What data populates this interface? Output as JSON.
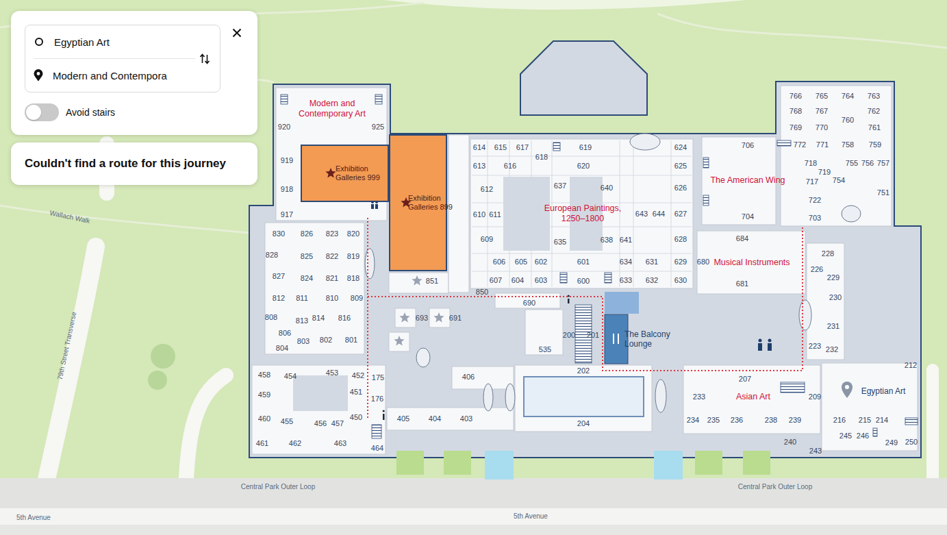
{
  "route_panel": {
    "from": "Egyptian Art",
    "to": "Modern and Contempora"
  },
  "avoid_stairs": {
    "label": "Avoid stairs",
    "on": false
  },
  "message": "Couldn't find a route for this journey",
  "areas": [
    {
      "text": "Modern and Contemporary Art",
      "kind": "department"
    },
    {
      "text": "Exhibition Galleries 999",
      "kind": "exhibition"
    },
    {
      "text": "Exhibition Galleries 899",
      "kind": "exhibition"
    },
    {
      "text": "European Paintings, 1250–1800",
      "kind": "department"
    },
    {
      "text": "The American Wing",
      "kind": "department"
    },
    {
      "text": "Musical Instruments",
      "kind": "department"
    },
    {
      "text": "Asian Art",
      "kind": "department"
    },
    {
      "text": "Egyptian Art",
      "kind": "venue"
    },
    {
      "text": "The Balcony Lounge",
      "kind": "venue"
    },
    {
      "text": "Wallach Walk",
      "kind": "street"
    },
    {
      "text": "79th Street Transverse",
      "kind": "street"
    },
    {
      "text": "Central Park Outer Loop",
      "kind": "street"
    },
    {
      "text": "Central Park Outer Loop",
      "kind": "street"
    },
    {
      "text": "5th Avenue",
      "kind": "street"
    },
    {
      "text": "5th Avenue",
      "kind": "street"
    }
  ],
  "rooms": [
    "920",
    "925",
    "919",
    "918",
    "917",
    "830",
    "826",
    "823",
    "820",
    "828",
    "825",
    "822",
    "819",
    "827",
    "824",
    "821",
    "818",
    "812",
    "811",
    "810",
    "809",
    "808",
    "813",
    "814",
    "816",
    "806",
    "803",
    "802",
    "801",
    "804",
    "851",
    "850",
    "690",
    "693",
    "691",
    "535",
    "200",
    "201",
    "202",
    "458",
    "454",
    "453",
    "452",
    "175",
    "176",
    "459",
    "451",
    "460",
    "455",
    "456",
    "457",
    "450",
    "461",
    "462",
    "463",
    "464",
    "406",
    "405",
    "404",
    "403",
    "204",
    "614",
    "615",
    "617",
    "618",
    "619",
    "624",
    "613",
    "616",
    "620",
    "625",
    "612",
    "637",
    "640",
    "626",
    "610",
    "611",
    "643",
    "644",
    "627",
    "609",
    "635",
    "638",
    "641",
    "628",
    "606",
    "605",
    "602",
    "601",
    "634",
    "631",
    "629",
    "607",
    "604",
    "603",
    "600",
    "633",
    "632",
    "630",
    "706",
    "766",
    "765",
    "764",
    "763",
    "768",
    "767",
    "762",
    "760",
    "769",
    "770",
    "761",
    "772",
    "771",
    "758",
    "759",
    "718",
    "719",
    "755",
    "756",
    "757",
    "717",
    "754",
    "722",
    "751",
    "704",
    "703",
    "684",
    "680",
    "681",
    "228",
    "226",
    "229",
    "230",
    "231",
    "223",
    "232",
    "207",
    "212",
    "233",
    "209",
    "234",
    "235",
    "236",
    "238",
    "239",
    "216",
    "215",
    "214",
    "245",
    "246",
    "240",
    "243",
    "249",
    "250"
  ]
}
